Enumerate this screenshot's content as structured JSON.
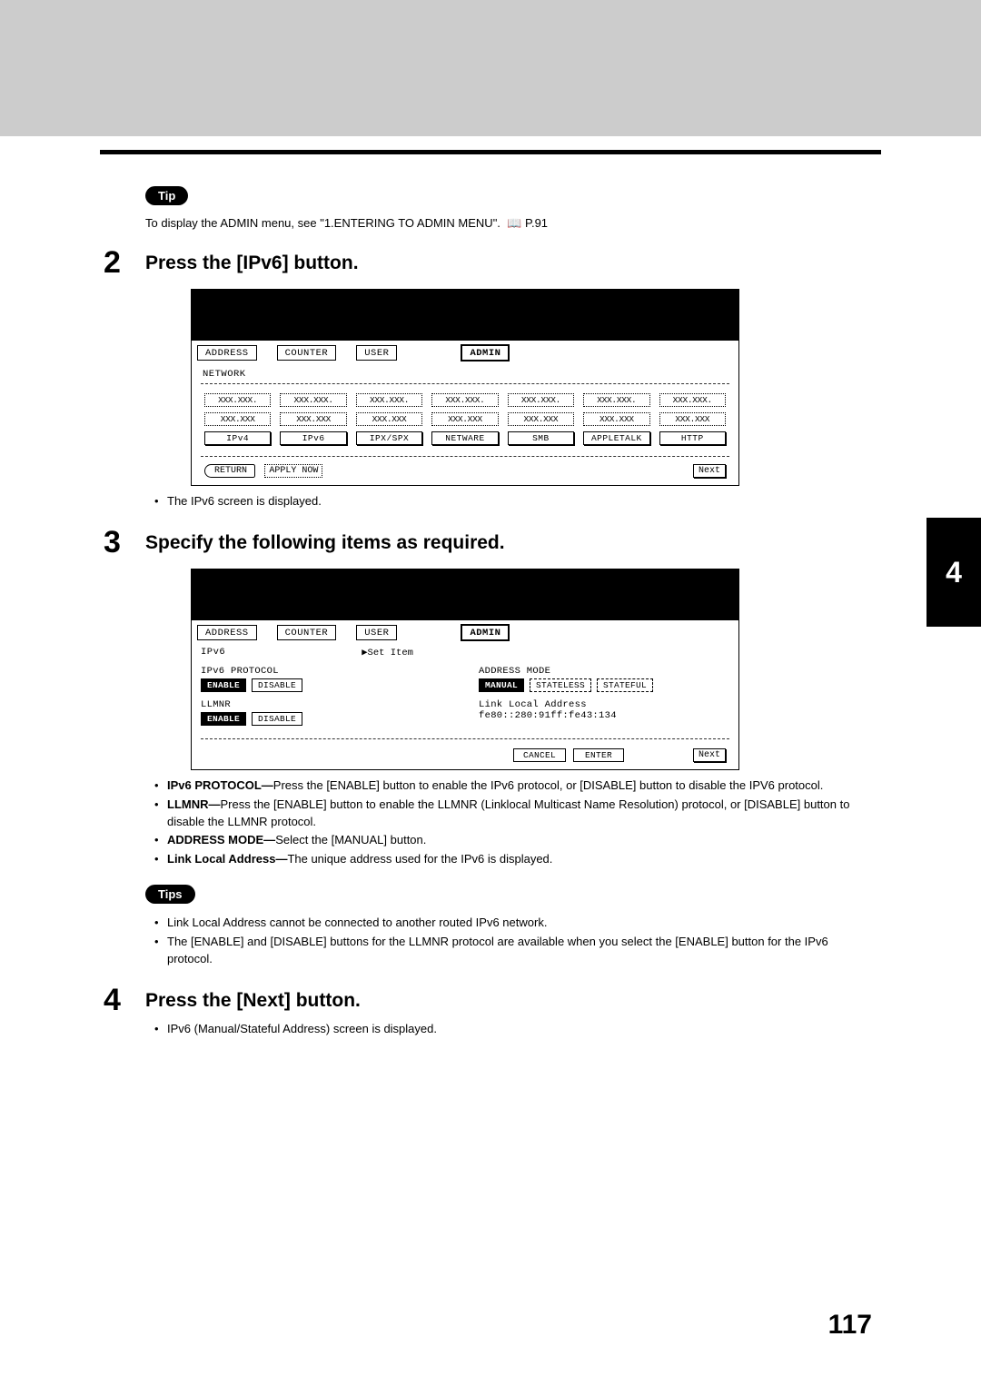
{
  "tip": {
    "badge": "Tip",
    "text_a": "To display the ADMIN menu, see \"1.ENTERING TO ADMIN MENU\".",
    "page_ref": "P.91"
  },
  "step2": {
    "num": "2",
    "title": "Press the [IPv6] button.",
    "result": "The IPv6 screen is displayed."
  },
  "screen1": {
    "tabs": [
      "ADDRESS",
      "COUNTER",
      "USER",
      "ADMIN"
    ],
    "crumb": "NETWORK",
    "grid_row1": [
      "XXX.XXX.",
      "XXX.XXX.",
      "XXX.XXX.",
      "XXX.XXX.",
      "XXX.XXX.",
      "XXX.XXX.",
      "XXX.XXX."
    ],
    "grid_row2": [
      "XXX.XXX",
      "XXX.XXX",
      "XXX.XXX",
      "XXX.XXX",
      "XXX.XXX",
      "XXX.XXX",
      "XXX.XXX"
    ],
    "grid_row3": [
      "IPv4",
      "IPv6",
      "IPX/SPX",
      "NETWARE",
      "SMB",
      "APPLETALK",
      "HTTP"
    ],
    "return": "RETURN",
    "apply": "APPLY NOW",
    "next": "Next"
  },
  "step3": {
    "num": "3",
    "title": "Specify the following items as required."
  },
  "screen2": {
    "tabs": [
      "ADDRESS",
      "COUNTER",
      "USER",
      "ADMIN"
    ],
    "crumb": "IPv6",
    "set_item": "▶Set Item",
    "left": {
      "proto_label": "IPv6 PROTOCOL",
      "enable": "ENABLE",
      "disable": "DISABLE",
      "llmnr_label": "LLMNR",
      "llmnr_enable": "ENABLE",
      "llmnr_disable": "DISABLE"
    },
    "right": {
      "addr_mode_label": "ADDRESS MODE",
      "manual": "MANUAL",
      "stateless": "STATELESS",
      "stateful": "STATEFUL",
      "link_local_label": "Link Local Address",
      "link_local_value": "fe80::280:91ff:fe43:134"
    },
    "cancel": "CANCEL",
    "enter": "ENTER",
    "next": "Next"
  },
  "bullets3": {
    "b1_bold": "IPv6 PROTOCOL—",
    "b1_rest": "Press the [ENABLE] button to enable the IPv6 protocol, or [DISABLE] button to disable the IPV6 protocol.",
    "b2_bold": "LLMNR—",
    "b2_rest": "Press the [ENABLE] button to enable the LLMNR (Linklocal Multicast Name Resolution) protocol, or [DISABLE] button to disable the LLMNR protocol.",
    "b3_bold": "ADDRESS MODE—",
    "b3_rest": "Select the [MANUAL] button.",
    "b4_bold": "Link Local Address—",
    "b4_rest": "The unique address used for the IPv6 is displayed."
  },
  "tips": {
    "badge": "Tips",
    "t1": "Link Local Address cannot be connected to another routed IPv6 network.",
    "t2": "The [ENABLE] and [DISABLE] buttons for the LLMNR protocol are available when you select the [ENABLE] button for the IPv6 protocol."
  },
  "step4": {
    "num": "4",
    "title": "Press the [Next] button.",
    "result": "IPv6 (Manual/Stateful Address) screen is displayed."
  },
  "side_tab": "4",
  "page_num": "117"
}
